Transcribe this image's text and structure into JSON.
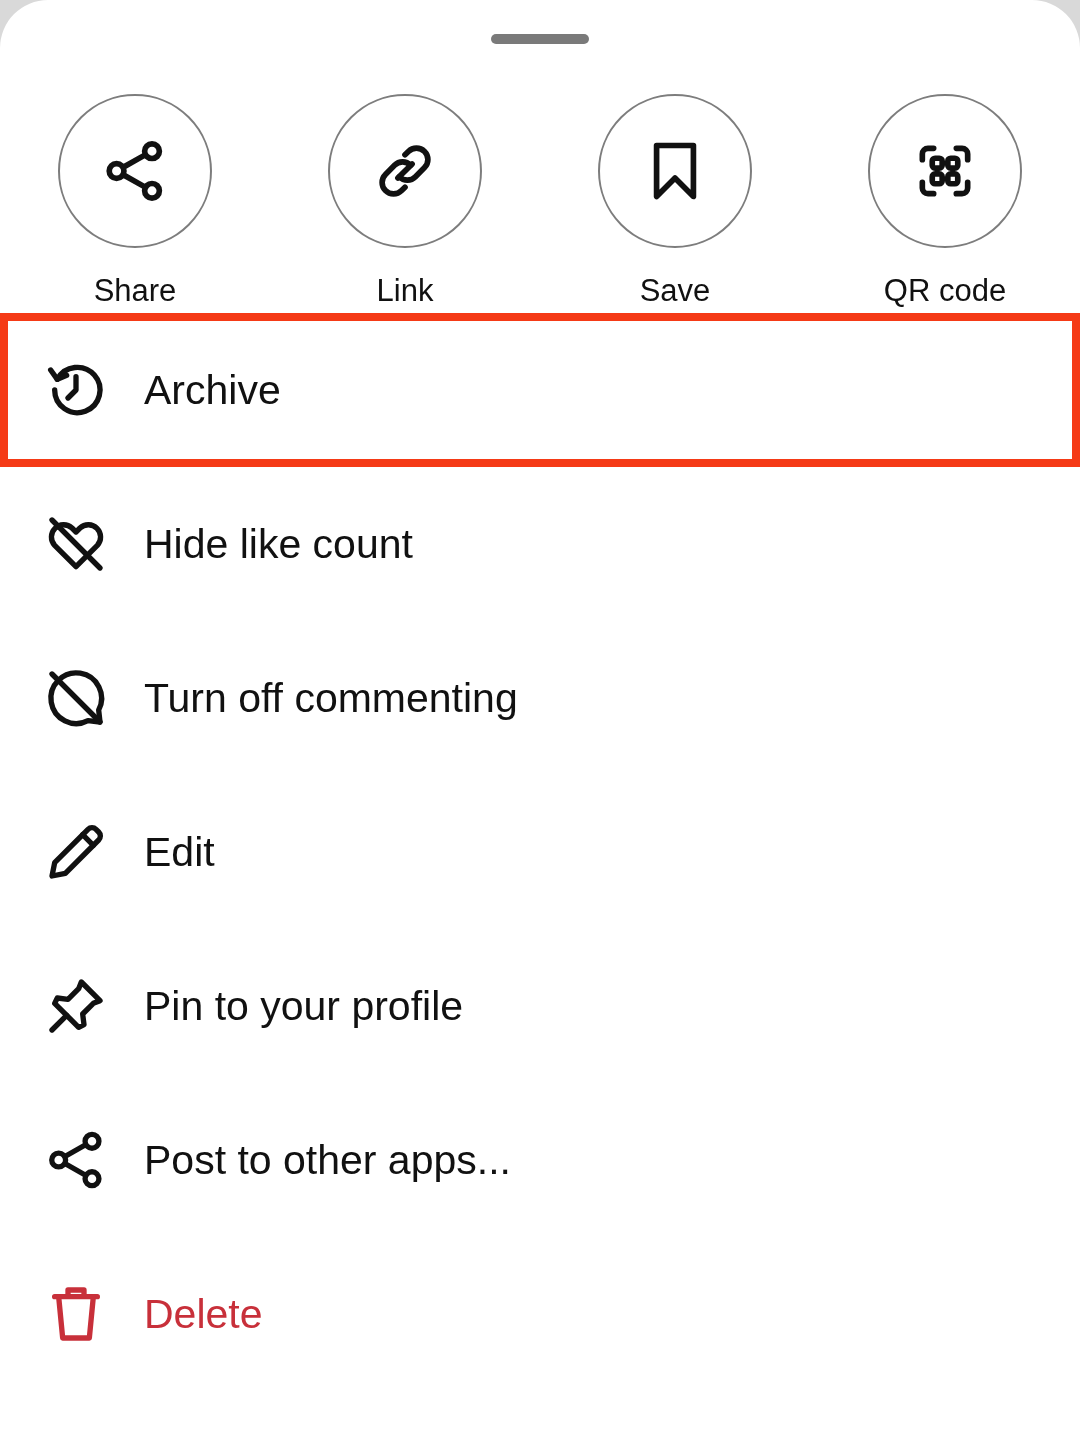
{
  "quick_actions": [
    {
      "label": "Share"
    },
    {
      "label": "Link"
    },
    {
      "label": "Save"
    },
    {
      "label": "QR code"
    }
  ],
  "menu_items": [
    {
      "label": "Archive",
      "highlighted": true,
      "destructive": false
    },
    {
      "label": "Hide like count",
      "highlighted": false,
      "destructive": false
    },
    {
      "label": "Turn off commenting",
      "highlighted": false,
      "destructive": false
    },
    {
      "label": "Edit",
      "highlighted": false,
      "destructive": false
    },
    {
      "label": "Pin to your profile",
      "highlighted": false,
      "destructive": false
    },
    {
      "label": "Post to other apps...",
      "highlighted": false,
      "destructive": false
    },
    {
      "label": "Delete",
      "highlighted": false,
      "destructive": true
    }
  ]
}
